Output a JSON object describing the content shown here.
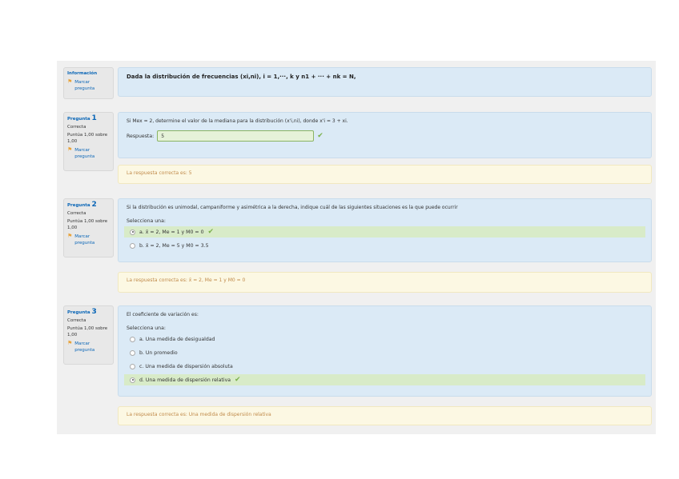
{
  "info": {
    "title": "Información",
    "flag_label": "Marcar pregunta",
    "text": "Dada la distribución de frecuencias (xi,ni), i = 1,···, k y n1 + ··· + nk = N,"
  },
  "questions": [
    {
      "label": "Pregunta",
      "number": "1",
      "status": "Correcta",
      "score": "Puntúa 1,00 sobre 1,00",
      "flag_label": "Marcar pregunta",
      "text": "Si Mex = 2, determine el valor de la mediana para la distribución (x'i,ni), donde x'i = 3 + xi.",
      "answer_label": "Respuesta:",
      "answer_value": "5",
      "feedback": "La respuesta correcta es: 5"
    },
    {
      "label": "Pregunta",
      "number": "2",
      "status": "Correcta",
      "score": "Puntúa 1,00 sobre 1,00",
      "flag_label": "Marcar pregunta",
      "text": "Si la distribución es unimodal, campaniforme y asimétrica a la derecha, indique cuál de las siguientes situaciones es la que puede ocurrir",
      "prompt": "Selecciona una:",
      "options": [
        {
          "text": "a. x̄ = 2, Me = 1 y M0 = 0",
          "selected": true,
          "correct": true
        },
        {
          "text": "b. x̄ = 2, Me = 5 y M0 = 3.5",
          "selected": false,
          "correct": false
        }
      ],
      "feedback": "La respuesta correcta es: x̄ = 2, Me = 1 y M0 = 0"
    },
    {
      "label": "Pregunta",
      "number": "3",
      "status": "Correcta",
      "score": "Puntúa 1,00 sobre 1,00",
      "flag_label": "Marcar pregunta",
      "text": "El coeficiente de variación es:",
      "prompt": "Selecciona una:",
      "options": [
        {
          "text": "a. Una medida de desigualdad",
          "selected": false,
          "correct": false
        },
        {
          "text": "b. Un promedio",
          "selected": false,
          "correct": false
        },
        {
          "text": "c. Una medida de dispersión absoluta",
          "selected": false,
          "correct": false
        },
        {
          "text": "d. Una medida de dispersión relativa",
          "selected": true,
          "correct": true
        }
      ],
      "feedback": "La respuesta correcta es: Una medida de dispersión relativa"
    }
  ],
  "colors": {
    "question_bg": "#dbeaf6",
    "feedback_bg": "#fcf8e3",
    "correct_bg": "#d8ebc8",
    "link": "#0a66b7",
    "check": "#7ab04a"
  }
}
